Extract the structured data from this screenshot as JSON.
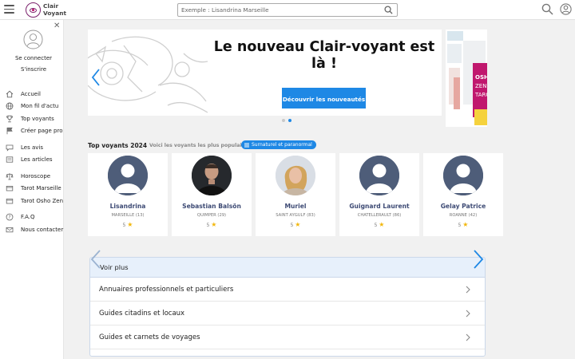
{
  "header": {
    "logo_line1": "Clair",
    "logo_line2": "Voyant",
    "search_placeholder": "Exemple : Lisandrina Marseille"
  },
  "sidebar": {
    "connect": "Se connecter",
    "register": "S'inscrire",
    "items": [
      {
        "label": "Accueil",
        "icon": "home-icon"
      },
      {
        "label": "Mon fil d'actu",
        "icon": "globe-icon"
      },
      {
        "label": "Top voyants",
        "icon": "trophy-icon"
      },
      {
        "label": "Créer page pro",
        "icon": "flag-icon"
      },
      {
        "label": "Les avis",
        "icon": "chat-icon"
      },
      {
        "label": "Les articles",
        "icon": "document-icon"
      },
      {
        "label": "Horoscope",
        "icon": "scales-icon"
      },
      {
        "label": "Tarot Marseille",
        "icon": "card-icon"
      },
      {
        "label": "Tarot Osho Zen",
        "icon": "card-icon"
      },
      {
        "label": "F.A.Q",
        "icon": "help-icon"
      },
      {
        "label": "Nous contacter",
        "icon": "mail-icon"
      }
    ]
  },
  "banner": {
    "title": "Le nouveau Clair-voyant est là !",
    "button": "Découvrir les nouveautés",
    "side_text": "OSHO ZEN TARO"
  },
  "top_voyants": {
    "title": "Top voyants 2024",
    "subtitle": "Voici les voyants les plus populaires",
    "chip": "Surnaturel et paranormal",
    "cards": [
      {
        "name": "Lisandrina",
        "city": "MARSEILLE (13)",
        "rating": "5",
        "photo": false
      },
      {
        "name": "Sebastian Balsön",
        "city": "QUIMPER (29)",
        "rating": "5",
        "photo": "man"
      },
      {
        "name": "Muriel",
        "city": "SAINT AYGULF (83)",
        "rating": "5",
        "photo": "woman"
      },
      {
        "name": "Guignard Laurent",
        "city": "CHATELLERAULT (86)",
        "rating": "5",
        "photo": false
      },
      {
        "name": "Gelay Patrice",
        "city": "ROANNE (42)",
        "rating": "5",
        "photo": false
      }
    ]
  },
  "voir_plus": {
    "title": "Voir plus",
    "rows": [
      "Annuaires professionnels et particuliers",
      "Guides citadins et locaux",
      "Guides et carnets de voyages"
    ]
  },
  "colors": {
    "accent": "#1e88e5",
    "name": "#3d4a74",
    "star": "#f2b70c",
    "header_band": "#e7f0fb"
  }
}
